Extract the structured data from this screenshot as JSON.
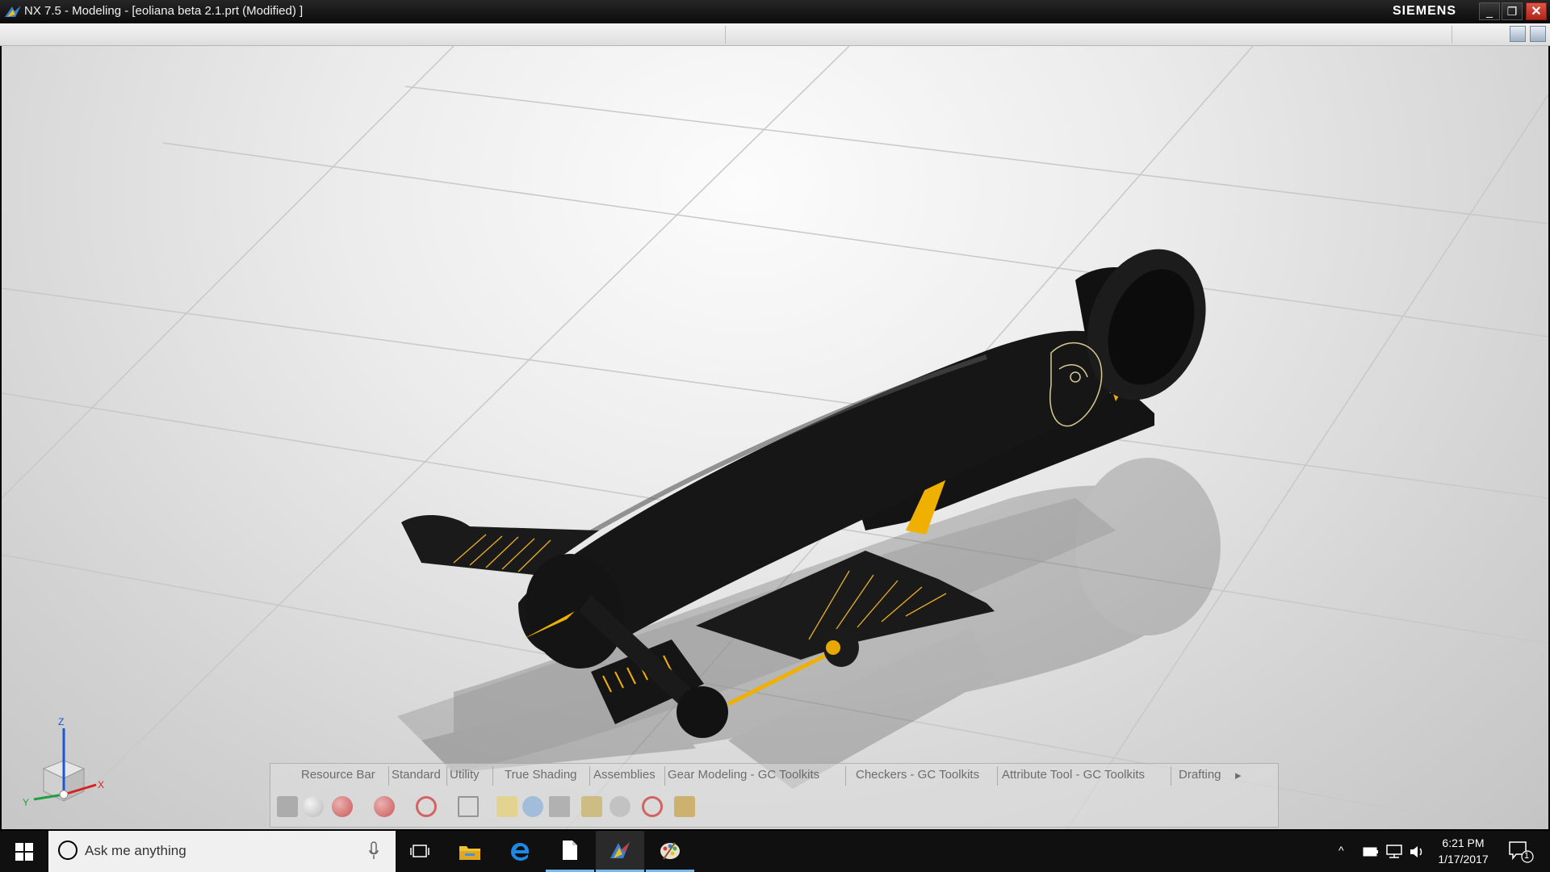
{
  "window": {
    "title": "NX 7.5 - Modeling - [eoliana beta 2.1.prt (Modified) ]",
    "brand": "SIEMENS",
    "controls": {
      "minimize": "_",
      "restore": "❐",
      "close": "✕"
    }
  },
  "viewport": {
    "background_colors": [
      "#fcfcfc",
      "#c4c4c4"
    ],
    "model_colors": {
      "body": "#161616",
      "accent": "#f0b000"
    },
    "triad": {
      "z": "Z",
      "x": "X",
      "y": "Y"
    }
  },
  "toolbar": {
    "tabs": [
      "Resource Bar",
      "Standard",
      "Utility",
      "True Shading",
      "Assemblies",
      "Gear Modeling - GC Toolkits",
      "Checkers - GC Toolkits",
      "Attribute Tool - GC Toolkits",
      "Drafting"
    ],
    "more": "▸",
    "settings_icon": "gear-icon"
  },
  "taskbar": {
    "search_placeholder": "Ask me anything",
    "apps": [
      "task-view-icon",
      "file-explorer-icon",
      "edge-icon",
      "document-icon",
      "nx-icon",
      "paint-icon"
    ],
    "tray": {
      "chevron": "^",
      "time": "6:21 PM",
      "date": "1/17/2017",
      "notifications": "1"
    }
  }
}
